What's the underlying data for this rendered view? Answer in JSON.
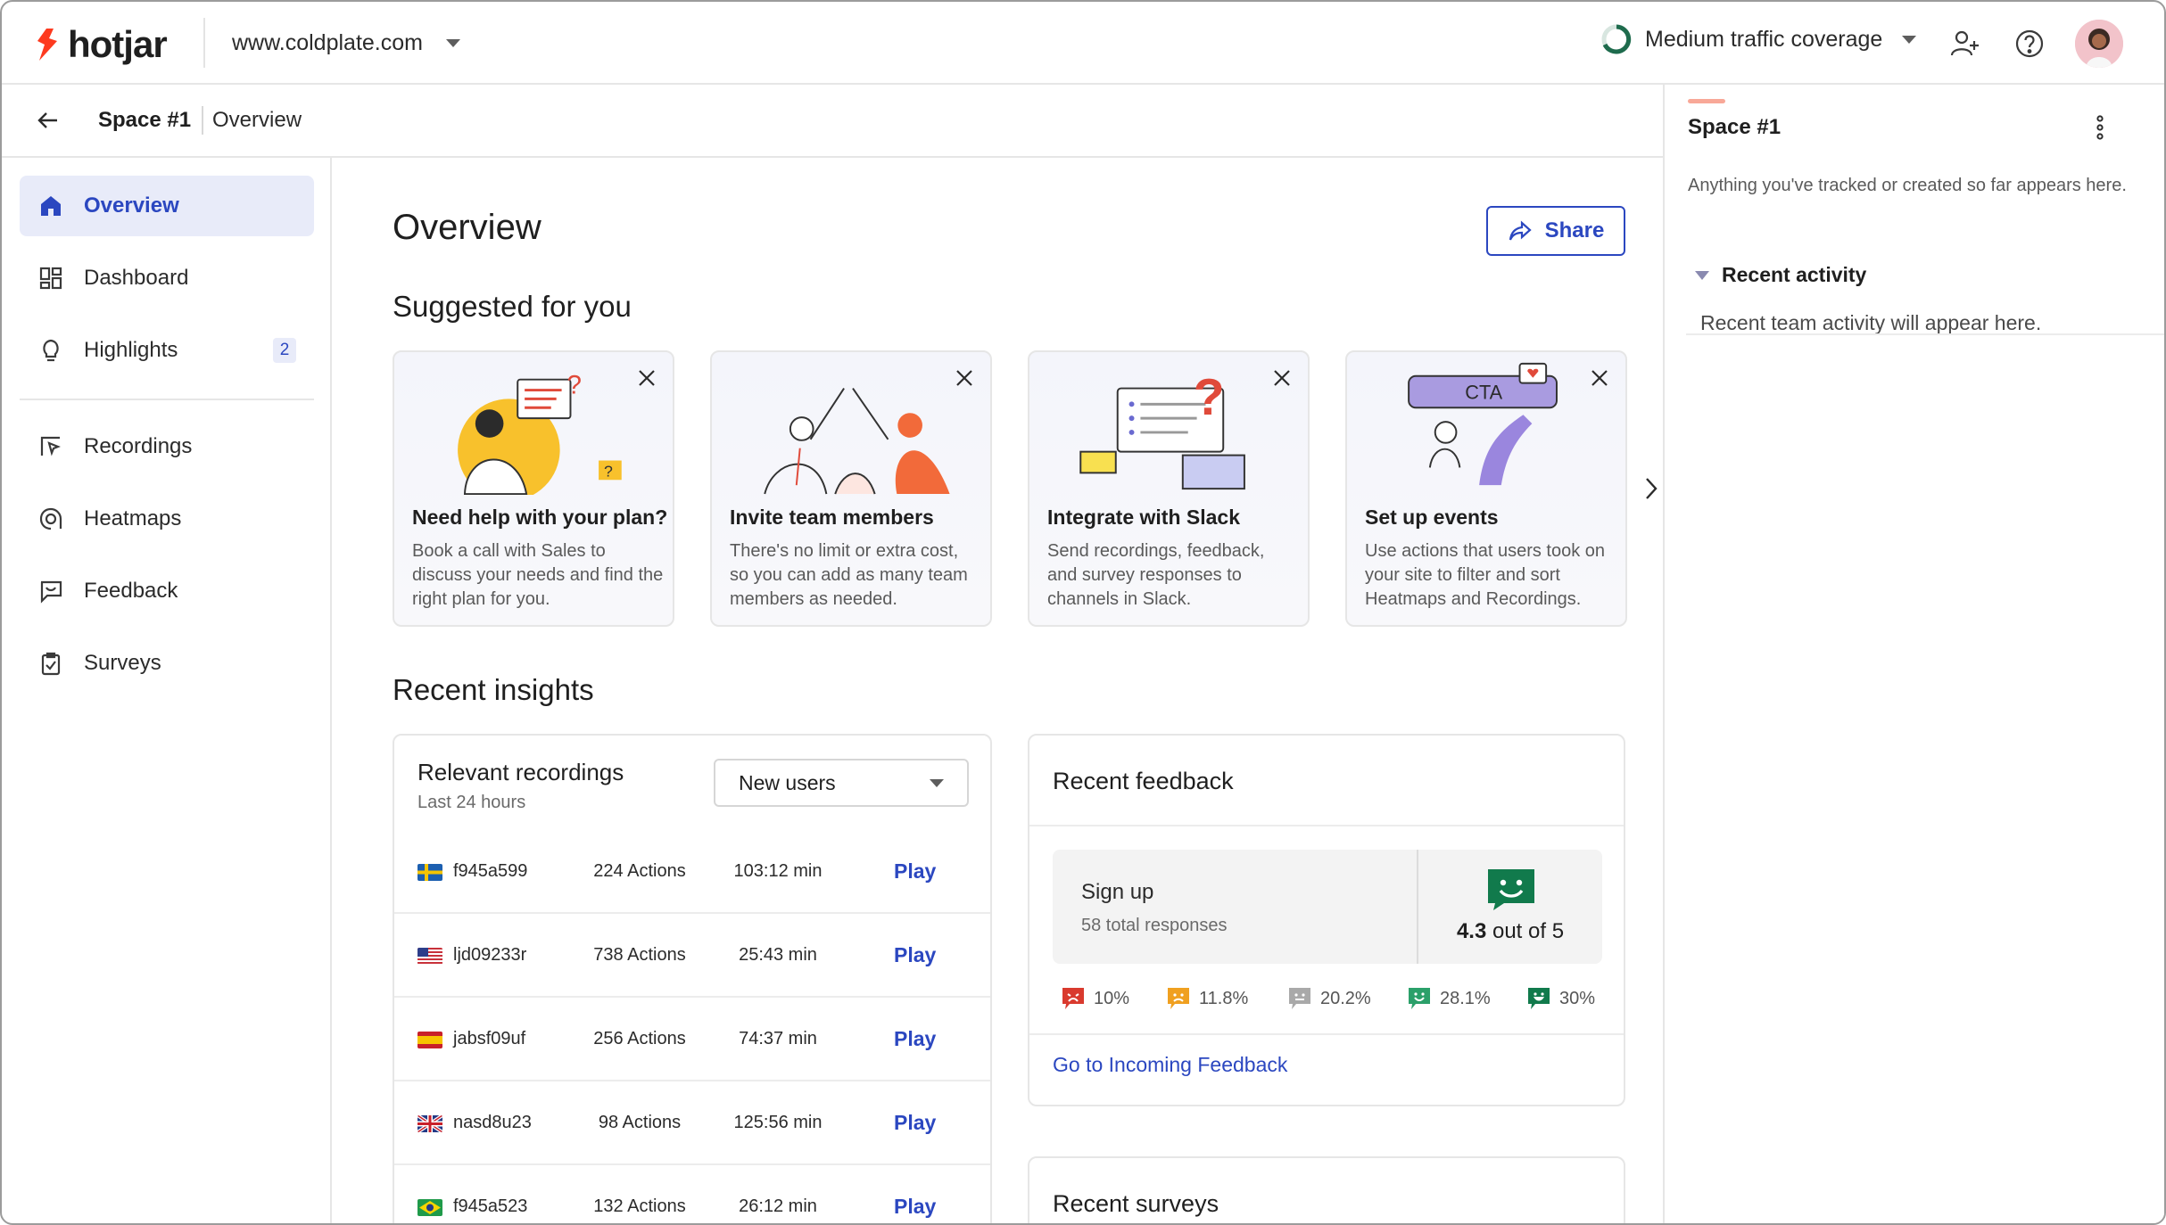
{
  "app": {
    "logo_text": "hotjar"
  },
  "topbar": {
    "site": "www.coldplate.com",
    "coverage": "Medium traffic coverage"
  },
  "breadcrumb": {
    "space": "Space #1",
    "page": "Overview"
  },
  "sidebar": {
    "items": [
      {
        "label": "Overview",
        "icon": "home-icon",
        "active": true
      },
      {
        "label": "Dashboard",
        "icon": "dashboard-icon"
      },
      {
        "label": "Highlights",
        "icon": "lightbulb-icon",
        "badge": "2"
      },
      {
        "label": "Recordings",
        "icon": "recordings-icon"
      },
      {
        "label": "Heatmaps",
        "icon": "heatmaps-icon"
      },
      {
        "label": "Feedback",
        "icon": "feedback-icon"
      },
      {
        "label": "Surveys",
        "icon": "surveys-icon"
      }
    ]
  },
  "main": {
    "title": "Overview",
    "share_label": "Share",
    "suggested_title": "Suggested for you",
    "suggestions": [
      {
        "title": "Need help with your plan?",
        "body": "Book a call with Sales to discuss your needs and find the right plan for you."
      },
      {
        "title": "Invite team members",
        "body": "There's no limit or extra cost, so you can add as many team members as needed."
      },
      {
        "title": "Integrate with Slack",
        "body": "Send recordings, feedback, and survey responses to channels in Slack."
      },
      {
        "title": "Set up events",
        "body": "Use actions that users took on your site to filter and sort Heatmaps and Recordings.",
        "cta": "CTA"
      }
    ],
    "insights_title": "Recent insights"
  },
  "recordings": {
    "title": "Relevant recordings",
    "subtitle": "Last 24 hours",
    "filter": "New users",
    "play_label": "Play",
    "rows": [
      {
        "flag": "sweden",
        "id": "f945a599",
        "actions": "224 Actions",
        "duration": "103:12 min"
      },
      {
        "flag": "usa",
        "id": "ljd09233r",
        "actions": "738 Actions",
        "duration": "25:43 min"
      },
      {
        "flag": "spain",
        "id": "jabsf09uf",
        "actions": "256 Actions",
        "duration": "74:37 min"
      },
      {
        "flag": "uk",
        "id": "nasd8u23",
        "actions": "98 Actions",
        "duration": "125:56 min"
      },
      {
        "flag": "brazil",
        "id": "f945a523",
        "actions": "132 Actions",
        "duration": "26:12 min"
      }
    ]
  },
  "feedback": {
    "title": "Recent feedback",
    "widget": "Sign up",
    "responses": "58 total responses",
    "score": "4.3",
    "score_suffix": "out of 5",
    "ratings": [
      {
        "pct": "10%",
        "color": "#d93a2e"
      },
      {
        "pct": "11.8%",
        "color": "#f0a020"
      },
      {
        "pct": "20.2%",
        "color": "#a9a9a9"
      },
      {
        "pct": "28.1%",
        "color": "#2ba06a"
      },
      {
        "pct": "30%",
        "color": "#117a4c"
      }
    ],
    "link": "Go to Incoming Feedback"
  },
  "surveys": {
    "title": "Recent surveys"
  },
  "rightpanel": {
    "title": "Space #1",
    "description": "Anything you've tracked or created so far appears here.",
    "section": "Recent activity",
    "empty": "Recent team activity will appear here."
  },
  "colors": {
    "accent": "#2b47c0",
    "brand": "#fd3a1f"
  }
}
